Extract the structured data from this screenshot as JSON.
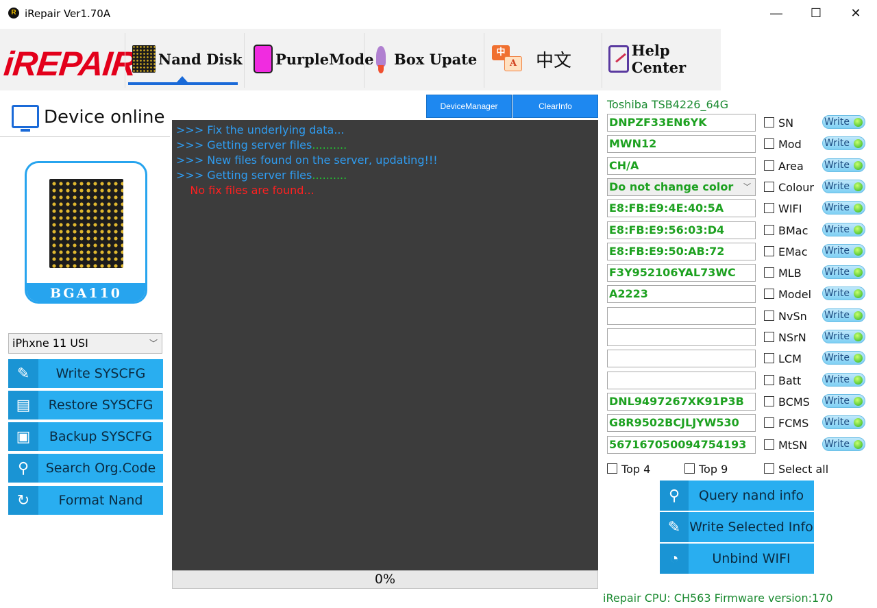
{
  "window": {
    "title": "iRepair Ver1.70A",
    "minimize": "—",
    "maximize": "☐",
    "close": "✕"
  },
  "toolbar": {
    "logo": "iREPAIR",
    "nand_disk": "Nand Disk",
    "purple_mode": "PurpleMode",
    "box_update": "Box Upate",
    "chinese": "中文",
    "help_center": "Help Center",
    "active": "Nand Disk",
    "accent": "#1a6ad8"
  },
  "device": {
    "status": "Device online",
    "chip_package": "BGA110",
    "model_selected": "iPhxne 11 USI"
  },
  "left_actions": [
    {
      "label": "Write SYSCFG",
      "icon": "edit-icon"
    },
    {
      "label": "Restore SYSCFG",
      "icon": "restore-icon"
    },
    {
      "label": "Backup SYSCFG",
      "icon": "backup-icon"
    },
    {
      "label": "Search Org.Code",
      "icon": "search-icon"
    },
    {
      "label": "Format Nand",
      "icon": "refresh-icon"
    }
  ],
  "top_buttons": {
    "device_manager": "DeviceManager",
    "clear_info": "ClearInfo"
  },
  "log": {
    "line1": ">>> Fix the underlying data...",
    "line2_prefix": ">>> Getting server files",
    "line2_suffix": "..........",
    "line3": ">>> New files found on the server, updating!!!",
    "line4_prefix": ">>> Getting server files",
    "line4_suffix": "..........",
    "line5": "    No fix files are found..."
  },
  "progress": {
    "text": "0%",
    "value": 0
  },
  "nand": {
    "chip_name": "Toshiba  TSB4226_64G"
  },
  "fields": [
    {
      "label": "SN",
      "value": "DNPZF33EN6YK"
    },
    {
      "label": "Mod",
      "value": "MWN12"
    },
    {
      "label": "Area",
      "value": "CH/A"
    },
    {
      "label": "Colour",
      "value": "Do not change color"
    },
    {
      "label": "WIFI",
      "value": "E8:FB:E9:4E:40:5A"
    },
    {
      "label": "BMac",
      "value": "E8:FB:E9:56:03:D4"
    },
    {
      "label": "EMac",
      "value": "E8:FB:E9:50:AB:72"
    },
    {
      "label": "MLB",
      "value": "F3Y952106YAL73WC"
    },
    {
      "label": "Model",
      "value": "A2223"
    },
    {
      "label": "NvSn",
      "value": ""
    },
    {
      "label": "NSrN",
      "value": ""
    },
    {
      "label": "LCM",
      "value": ""
    },
    {
      "label": "Batt",
      "value": ""
    },
    {
      "label": "BCMS",
      "value": "DNL9497267XK91P3B"
    },
    {
      "label": "FCMS",
      "value": "G8R9502BCJLJYW530"
    },
    {
      "label": "MtSN",
      "value": "567167050094754193"
    }
  ],
  "write_label": "Write",
  "selectors": {
    "top4": "Top 4",
    "top9": "Top 9",
    "select_all": "Select all"
  },
  "right_actions": {
    "query": "Query nand info",
    "write_selected": "Write Selected Info",
    "unbind": "Unbind WIFI"
  },
  "status_bar": "iRepair CPU: CH563 Firmware version:170"
}
